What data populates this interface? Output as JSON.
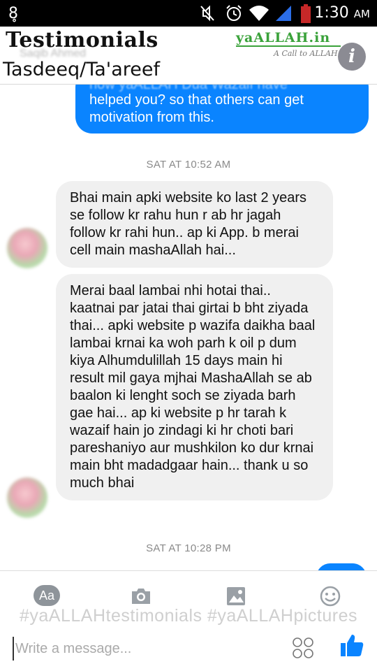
{
  "status_bar": {
    "time": "1:30",
    "ampm": "AM"
  },
  "header": {
    "title": "Testimonials",
    "subtitle": "Tasdeeq/Ta'areef",
    "contact_name": "Saqib Ahmed",
    "logo_text": "yaALLAH.in",
    "logo_tagline": "A Call to ALLAH!",
    "info_label": "i"
  },
  "messages": {
    "outgoing_top": {
      "partial_line": "how yaALLAH Dua Wazaif have",
      "text": "helped you? so that others can get motivation from this."
    },
    "timestamp_1": "SAT AT 10:52 AM",
    "incoming_1": "Bhai main apki website ko last 2 years se follow kr rahu hun r ab hr jagah follow kr rahi hun.. ap ki App. b merai cell main mashaAllah hai...",
    "incoming_2": "Merai baal lambai nhi hotai thai.. kaatnai par jatai thai girtai b bht ziyada thai... apki website p wazifa daikha baal lambai krnai ka woh parh k oil p dum kiya Alhumdulillah 15 days main hi result mil gaya mjhai MashaAllah se ab baalon ki lenght soch se ziyada barh gae hai... ap ki website p hr tarah k wazaif hain jo zindagi ki hr choti bari pareshaniyo aur mushkilon ko dur krnai main bht madadgaar hain... thank u so much bhai",
    "timestamp_2": "SAT AT 10:28 PM"
  },
  "composer": {
    "aa_label": "Aa",
    "hashtags": "#yaALLAHtestimonials #yaALLAHpictures",
    "placeholder": "Write a message..."
  },
  "colors": {
    "accent": "#0a84ff",
    "incoming_bubble": "#f0f0f0",
    "logo_green": "#3aa23a"
  },
  "icons": [
    "status-app-icon",
    "mute-icon",
    "alarm-icon",
    "wifi-icon",
    "signal-icon",
    "battery-icon",
    "info-icon",
    "camera-icon",
    "gallery-icon",
    "emoji-icon",
    "sticker-grid-icon",
    "like-icon"
  ]
}
